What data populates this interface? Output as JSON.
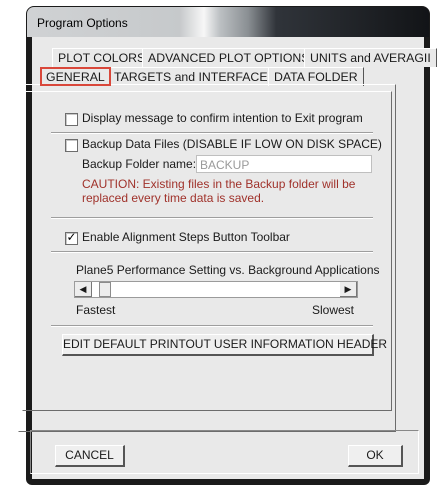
{
  "window": {
    "title": "Program Options"
  },
  "tabs": {
    "row1": [
      "PLOT COLORS",
      "ADVANCED PLOT OPTIONS",
      "UNITS and AVERAGII"
    ],
    "row2": [
      "GENERAL",
      "TARGETS and INTERFACES",
      "DATA FOLDER"
    ],
    "active": "GENERAL"
  },
  "general": {
    "confirm_exit": {
      "label": "Display message to confirm intention to Exit program",
      "checked": false
    },
    "backup": {
      "label": "Backup  Data Files (DISABLE IF LOW ON DISK SPACE)",
      "checked": false
    },
    "backup_folder": {
      "label": "Backup Folder name:",
      "value": "BACKUP"
    },
    "caution_line1": "CAUTION: Existing files in the Backup folder will be",
    "caution_line2": "replaced every time data is saved.",
    "toolbar": {
      "label": "Enable Alignment Steps Button Toolbar",
      "checked": true,
      "mark": "✓"
    },
    "performance": {
      "title": "Plane5 Performance Setting vs. Background Applications",
      "min_label": "Fastest",
      "max_label": "Slowest",
      "left_arrow": "◀",
      "right_arrow": "▶",
      "value": 0.03
    },
    "edit_header_button": "EDIT DEFAULT PRINTOUT USER INFORMATION HEADER"
  },
  "buttons": {
    "cancel": "CANCEL",
    "ok": "OK"
  },
  "colors": {
    "caution": "#a0322b",
    "active_tab_highlight": "#d9473a"
  }
}
